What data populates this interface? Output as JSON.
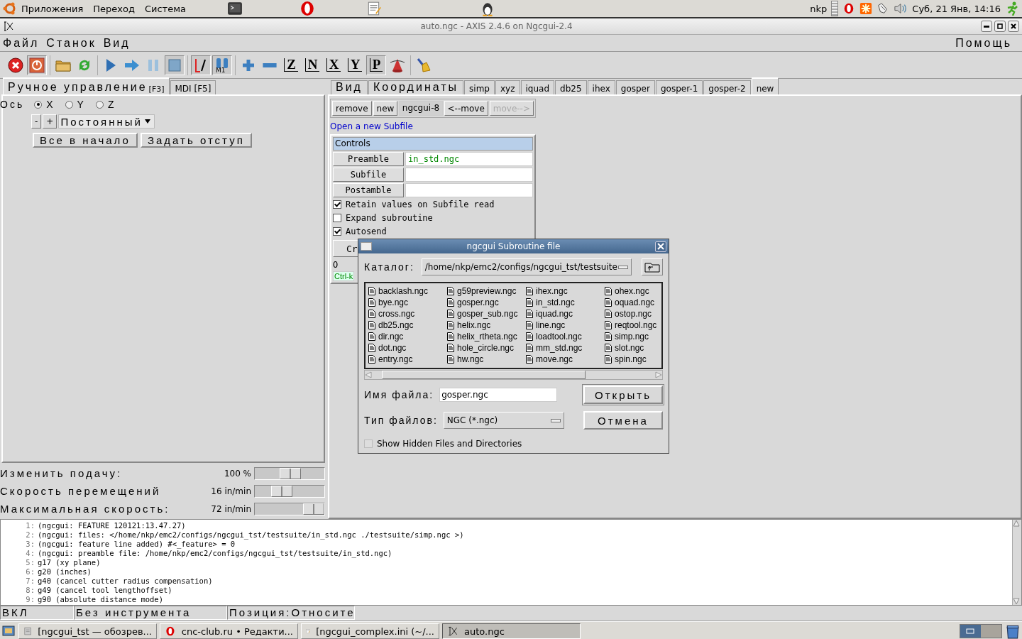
{
  "top_panel": {
    "menus": [
      "Приложения",
      "Переход",
      "Система"
    ],
    "user": "nkp",
    "clock": "Суб, 21 Янв, 14:16"
  },
  "window": {
    "title": "auto.ngc - AXIS 2.4.6 on Ngcgui-2.4"
  },
  "menu_bar": {
    "left": [
      "Файл",
      "Станок",
      "Вид"
    ],
    "right": [
      "Помощь"
    ]
  },
  "toolbar_groups": [
    {
      "buttons": [
        {
          "kind": "estop",
          "pressed": false
        },
        {
          "kind": "power",
          "pressed": true
        }
      ]
    },
    {
      "buttons": [
        {
          "kind": "open",
          "pressed": false
        },
        {
          "kind": "reload",
          "pressed": false
        }
      ]
    },
    {
      "buttons": [
        {
          "kind": "run",
          "pressed": false
        },
        {
          "kind": "step",
          "pressed": false
        },
        {
          "kind": "pause",
          "pressed": false
        },
        {
          "kind": "stop",
          "pressed": true
        }
      ]
    },
    {
      "buttons": [
        {
          "kind": "block-delete",
          "pressed": true
        },
        {
          "kind": "optional-stop",
          "label": "M1",
          "pressed": true
        }
      ]
    },
    {
      "buttons": [
        {
          "kind": "zoom-in",
          "pressed": false
        },
        {
          "kind": "zoom-out",
          "pressed": false
        },
        {
          "kind": "view",
          "label": "Z",
          "pressed": false
        },
        {
          "kind": "view",
          "label": "N",
          "pressed": false
        },
        {
          "kind": "view",
          "label": "X",
          "pressed": false
        },
        {
          "kind": "view",
          "label": "Y",
          "pressed": false
        },
        {
          "kind": "view",
          "label": "P",
          "pressed": true
        },
        {
          "kind": "rotate",
          "pressed": false
        }
      ]
    },
    {
      "buttons": [
        {
          "kind": "clear",
          "pressed": false
        }
      ]
    }
  ],
  "left_tabs": [
    {
      "label": "Ручное управление",
      "hotkey": "[F3]",
      "selected": true
    },
    {
      "label": "MDI [F5]",
      "selected": false
    }
  ],
  "manual": {
    "axis_label": "Ось",
    "axes": [
      {
        "label": "X",
        "selected": true
      },
      {
        "label": "Y",
        "selected": false
      },
      {
        "label": "Z",
        "selected": false
      }
    ],
    "jog_buttons": [
      "-",
      "+"
    ],
    "jog_mode": "Постоянный",
    "buttons": [
      "Все в начало",
      "Задать отступ"
    ]
  },
  "sliders": [
    {
      "label": "Изменить подачу:",
      "reading": "100 %",
      "level": 0.51
    },
    {
      "label": "Скорость перемещений",
      "reading": "16 in/min",
      "level": 0.34
    },
    {
      "label": "Максимальная скорость:",
      "reading": "72 in/min",
      "level": 1.0
    }
  ],
  "right_tabs": [
    {
      "label": "Вид",
      "kind": "big",
      "selected": false
    },
    {
      "label": "Координаты",
      "kind": "big",
      "selected": false
    },
    {
      "label": "simp",
      "kind": "small",
      "selected": false
    },
    {
      "label": "xyz",
      "kind": "small",
      "selected": false
    },
    {
      "label": "iquad",
      "kind": "small",
      "selected": false
    },
    {
      "label": "db25",
      "kind": "small",
      "selected": false
    },
    {
      "label": "ihex",
      "kind": "small",
      "selected": false
    },
    {
      "label": "gosper",
      "kind": "small",
      "selected": false
    },
    {
      "label": "gosper-1",
      "kind": "small",
      "selected": false
    },
    {
      "label": "gosper-2",
      "kind": "small",
      "selected": false
    },
    {
      "label": "new",
      "kind": "small",
      "selected": true
    }
  ],
  "ngcgui": {
    "buttons": [
      {
        "label": "remove",
        "disabled": false
      },
      {
        "label": "new",
        "disabled": false
      }
    ],
    "page_name": "ngcgui-8",
    "move_buttons": [
      {
        "label": "<--move",
        "disabled": false
      },
      {
        "label": "move-->",
        "disabled": true
      }
    ],
    "link": "Open a new Subfile",
    "controls_title": "Controls",
    "files": [
      {
        "label": "Preamble",
        "value": "in_std.ngc"
      },
      {
        "label": "Subfile"
      },
      {
        "label": "Postamble"
      }
    ],
    "options": [
      {
        "label": "Retain values on Subfile read",
        "checked": true
      },
      {
        "label": "Expand subroutine",
        "checked": false
      },
      {
        "label": "Autosend",
        "checked": true
      }
    ],
    "partial_button": "Cr",
    "partial_label": "O",
    "hint": "Ctrl-k"
  },
  "dialog": {
    "title": "ngcgui Subroutine file",
    "folder_label": "Каталог:",
    "folder": "/home/nkp/emc2/configs/ngcgui_tst/testsuite",
    "files": [
      "backlash.ngc",
      "bye.ngc",
      "cross.ngc",
      "db25.ngc",
      "dir.ngc",
      "dot.ngc",
      "entry.ngc",
      "g59preview.ngc",
      "gosper.ngc",
      "gosper_sub.ngc",
      "helix.ngc",
      "helix_rtheta.ngc",
      "hole_circle.ngc",
      "hw.ngc",
      "ihex.ngc",
      "in_std.ngc",
      "iquad.ngc",
      "line.ngc",
      "loadtool.ngc",
      "mm_std.ngc",
      "move.ngc",
      "ohex.ngc",
      "oquad.ngc",
      "ostop.ngc",
      "reqtool.ngc",
      "simp.ngc",
      "slot.ngc",
      "spin.ngc"
    ],
    "filename_label": "Имя файла:",
    "filename": "gosper.ngc",
    "open_button": "Открыть",
    "type_label": "Тип файлов:",
    "type": "NGC (*.ngc)",
    "cancel_button": "Отмена",
    "show_hidden": {
      "label": "Show Hidden Files and Directories",
      "checked": false
    }
  },
  "log": [
    {
      "number": "1:",
      "text": "(ngcgui: FEATURE 120121:13.47.27)"
    },
    {
      "number": "2:",
      "text": "(ngcgui: files: </home/nkp/emc2/configs/ngcgui_tst/testsuite/in_std.ngc ./testsuite/simp.ngc >)"
    },
    {
      "number": "3:",
      "text": "(ngcgui: feature line added) #<_feature> = 0"
    },
    {
      "number": "4:",
      "text": "(ngcgui: preamble file: /home/nkp/emc2/configs/ngcgui_tst/testsuite/in_std.ngc)"
    },
    {
      "number": "5:",
      "text": "g17 (xy plane)"
    },
    {
      "number": "6:",
      "text": "g20 (inches)"
    },
    {
      "number": "7:",
      "text": "g40 (cancel cutter radius compensation)"
    },
    {
      "number": "8:",
      "text": "g49 (cancel tool lengthoffset)"
    },
    {
      "number": "9:",
      "text": "g90 (absolute distance mode)"
    }
  ],
  "status_bar": [
    "ВКЛ",
    "Без инструмента",
    "Позиция:Относите"
  ],
  "taskbar": [
    {
      "kind": "folder",
      "label": "[ngcgui_tst — обозрев...",
      "selected": false
    },
    {
      "kind": "browser",
      "label": "cnc-club.ru • Редакти...",
      "selected": false
    },
    {
      "kind": "editor",
      "label": "[ngcgui_complex.ini (~/...",
      "selected": false
    },
    {
      "kind": "axis",
      "label": "auto.ngc",
      "selected": true
    }
  ]
}
